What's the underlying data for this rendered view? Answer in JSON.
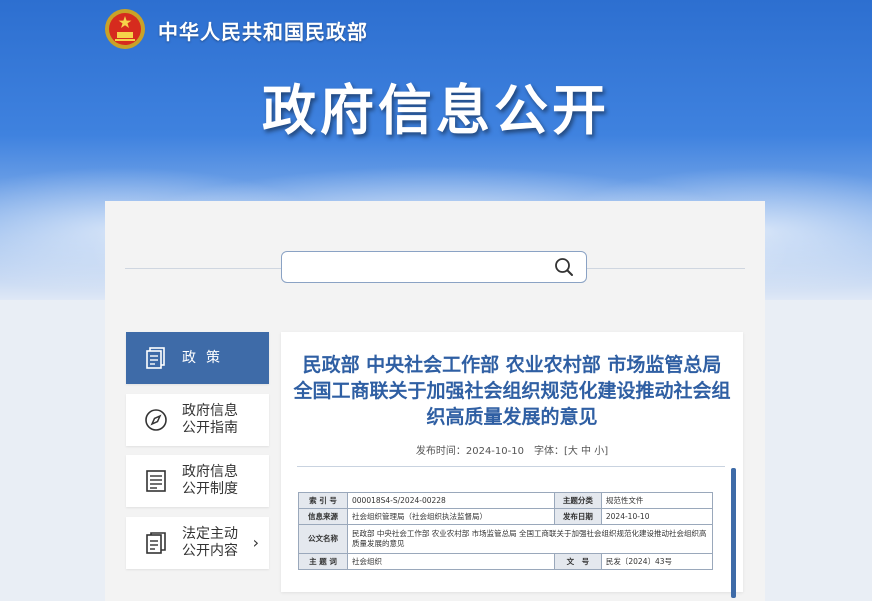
{
  "header": {
    "org_name": "中华人民共和国民政部",
    "page_title": "政府信息公开"
  },
  "search": {
    "value": "",
    "placeholder": ""
  },
  "sidebar": {
    "items": [
      {
        "label": "政策",
        "icon": "document-stack-icon",
        "active": true
      },
      {
        "label_lines": [
          "政府信息",
          "公开指南"
        ],
        "icon": "compass-icon"
      },
      {
        "label_lines": [
          "政府信息",
          "公开制度"
        ],
        "icon": "list-document-icon"
      },
      {
        "label_lines": [
          "法定主动",
          "公开内容"
        ],
        "icon": "document-icon",
        "chevron": "›"
      }
    ]
  },
  "article": {
    "title_lines": [
      "民政部 中央社会工作部 农业农村部 市场监管总局",
      "全国工商联关于加强社会组织规范化建设推动社会组",
      "织高质量发展的意见"
    ],
    "meta": "发布时间：2024-10-10　字体：[大 中 小]",
    "info_table": {
      "rows": [
        {
          "k1": "索 引 号",
          "v1": "000018S4-S/2024-00228",
          "k2": "主题分类",
          "v2": "规范性文件"
        },
        {
          "k1": "信息来源",
          "v1": "社会组织管理局（社会组织执法监督局）",
          "k2": "发布日期",
          "v2": "2024-10-10"
        },
        {
          "k1": "公文名称",
          "v1": "民政部 中央社会工作部 农业农村部 市场监管总局 全国工商联关于加强社会组织规范化建设推动社会组织高质量发展的意见"
        },
        {
          "k1": "主 题 词",
          "v1": "社会组织",
          "k2": "文　号",
          "v2": "民发〔2024〕43号"
        }
      ]
    }
  },
  "colors": {
    "accent": "#3e6ba8",
    "title_blue": "#2f5fa3",
    "panel_bg": "#f3f3f3"
  }
}
